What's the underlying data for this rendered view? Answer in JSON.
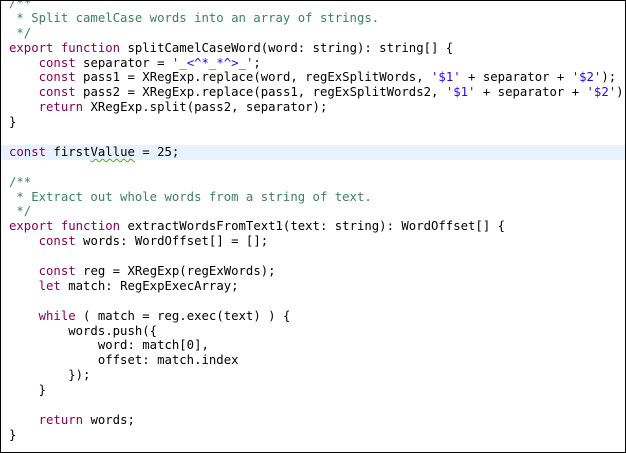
{
  "editor": {
    "lines": [
      [
        {
          "t": "c",
          "v": "/**"
        }
      ],
      [
        {
          "t": "c",
          "v": " * Split camelCase words into an array of strings."
        }
      ],
      [
        {
          "t": "c",
          "v": " */"
        }
      ],
      [
        {
          "t": "k",
          "v": "export function"
        },
        {
          "t": "p",
          "v": " splitCamelCaseWord(word: string): string[] {"
        }
      ],
      [
        {
          "t": "p",
          "v": "    "
        },
        {
          "t": "k",
          "v": "const"
        },
        {
          "t": "p",
          "v": " separator = "
        },
        {
          "t": "s",
          "v": "'_<^*_*^>_'"
        },
        {
          "t": "p",
          "v": ";"
        }
      ],
      [
        {
          "t": "p",
          "v": "    "
        },
        {
          "t": "k",
          "v": "const"
        },
        {
          "t": "p",
          "v": " pass1 = XRegExp.replace(word, regExSplitWords, "
        },
        {
          "t": "s",
          "v": "'$1'"
        },
        {
          "t": "p",
          "v": " + separator + "
        },
        {
          "t": "s",
          "v": "'$2'"
        },
        {
          "t": "p",
          "v": ");"
        }
      ],
      [
        {
          "t": "p",
          "v": "    "
        },
        {
          "t": "k",
          "v": "const"
        },
        {
          "t": "p",
          "v": " pass2 = XRegExp.replace(pass1, regExSplitWords2, "
        },
        {
          "t": "s",
          "v": "'$1'"
        },
        {
          "t": "p",
          "v": " + separator + "
        },
        {
          "t": "s",
          "v": "'$2'"
        },
        {
          "t": "p",
          "v": ");"
        }
      ],
      [
        {
          "t": "p",
          "v": "    "
        },
        {
          "t": "k",
          "v": "return"
        },
        {
          "t": "p",
          "v": " XRegExp.split(pass2, separator);"
        }
      ],
      [
        {
          "t": "p",
          "v": "}"
        }
      ],
      [],
      [
        {
          "t": "k",
          "v": "const"
        },
        {
          "t": "p",
          "v": " first"
        },
        {
          "t": "w",
          "v": "Vallue"
        },
        {
          "t": "p",
          "v": " = 25;"
        }
      ],
      [],
      [
        {
          "t": "c",
          "v": "/**"
        }
      ],
      [
        {
          "t": "c",
          "v": " * Extract out whole words from a string of text."
        }
      ],
      [
        {
          "t": "c",
          "v": " */"
        }
      ],
      [
        {
          "t": "k",
          "v": "export function"
        },
        {
          "t": "p",
          "v": " extractWordsFromText1(text: string): WordOffset[] {"
        }
      ],
      [
        {
          "t": "p",
          "v": "    "
        },
        {
          "t": "k",
          "v": "const"
        },
        {
          "t": "p",
          "v": " words: WordOffset[] = [];"
        }
      ],
      [],
      [
        {
          "t": "p",
          "v": "    "
        },
        {
          "t": "k",
          "v": "const"
        },
        {
          "t": "p",
          "v": " reg = XRegExp(regExWords);"
        }
      ],
      [
        {
          "t": "p",
          "v": "    "
        },
        {
          "t": "k",
          "v": "let"
        },
        {
          "t": "p",
          "v": " match: RegExpExecArray;"
        }
      ],
      [],
      [
        {
          "t": "p",
          "v": "    "
        },
        {
          "t": "k",
          "v": "while"
        },
        {
          "t": "p",
          "v": " ( match = reg.exec(text) ) {"
        }
      ],
      [
        {
          "t": "p",
          "v": "        words.push({"
        }
      ],
      [
        {
          "t": "p",
          "v": "            word: match[0],"
        }
      ],
      [
        {
          "t": "p",
          "v": "            offset: match.index"
        }
      ],
      [
        {
          "t": "p",
          "v": "        });"
        }
      ],
      [
        {
          "t": "p",
          "v": "    }"
        }
      ],
      [],
      [
        {
          "t": "p",
          "v": "    "
        },
        {
          "t": "k",
          "v": "return"
        },
        {
          "t": "p",
          "v": " words;"
        }
      ],
      [
        {
          "t": "p",
          "v": "}"
        }
      ]
    ],
    "current_line_index": 10,
    "colors": {
      "comment": "#3f7f5f",
      "keyword": "#7f0055",
      "string": "#2a00ff",
      "text": "#000000",
      "spell_warning": "#5aa02c",
      "current_line_bg": "#e8f2fe"
    }
  }
}
